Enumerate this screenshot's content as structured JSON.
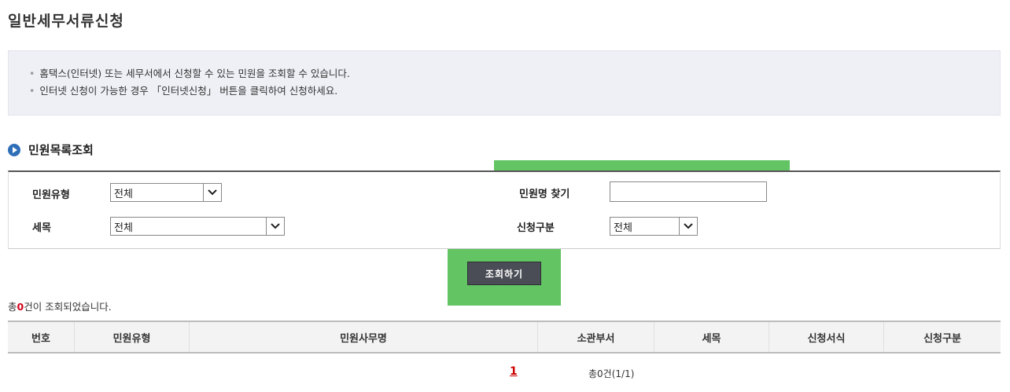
{
  "page_title": "일반세무서류신청",
  "info": {
    "lines": [
      "홈택스(인터넷) 또는 세무서에서 신청할 수 있는 민원을 조회할 수 있습니다.",
      "인터넷 신청이 가능한 경우 「인터넷신청」 버튼을 클릭하여 신청하세요."
    ]
  },
  "section": {
    "title": "민원목록조회"
  },
  "search": {
    "type_label": "민원유형",
    "type_value": "전체",
    "tax_label": "세목",
    "tax_value": "전체",
    "name_label": "민원명 찾기",
    "name_value": "",
    "apply_label": "신청구분",
    "apply_value": "전체",
    "button_label": "조회하기"
  },
  "result": {
    "prefix": "총",
    "count": "0",
    "suffix": "건이 조회되었습니다."
  },
  "table": {
    "headers": [
      "번호",
      "민원유형",
      "민원사무명",
      "소관부서",
      "세목",
      "신청서식",
      "신청구분"
    ]
  },
  "pager": {
    "page": "1",
    "total": "총0건(1/1)"
  },
  "colors": {
    "highlight": "#62c462",
    "accent": "#2f6fb8",
    "count": "#d4001a"
  },
  "icons": [
    "section-bullet-icon",
    "chevron-down-icon"
  ]
}
